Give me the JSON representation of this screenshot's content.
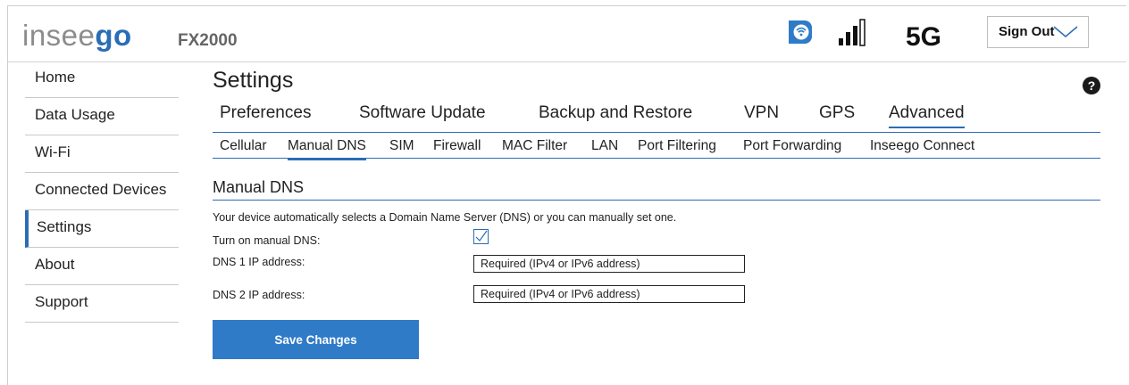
{
  "header": {
    "logo_prefix": "insee",
    "logo_suffix": "go",
    "model": "FX2000",
    "network": "5G",
    "sign_out_label": "Sign Out"
  },
  "sidebar": {
    "items": [
      {
        "label": "Home"
      },
      {
        "label": "Data Usage"
      },
      {
        "label": "Wi-Fi"
      },
      {
        "label": "Connected Devices"
      },
      {
        "label": "Settings",
        "active": true
      },
      {
        "label": "About"
      },
      {
        "label": "Support"
      }
    ]
  },
  "main": {
    "title": "Settings",
    "help_label": "?",
    "tabs": [
      {
        "label": "Preferences"
      },
      {
        "label": "Software Update"
      },
      {
        "label": "Backup and Restore"
      },
      {
        "label": "VPN"
      },
      {
        "label": "GPS"
      },
      {
        "label": "Advanced",
        "active": true
      }
    ],
    "subtabs": [
      {
        "label": "Cellular"
      },
      {
        "label": "Manual DNS",
        "active": true
      },
      {
        "label": "SIM"
      },
      {
        "label": "Firewall"
      },
      {
        "label": "MAC Filter"
      },
      {
        "label": "LAN"
      },
      {
        "label": "Port Filtering"
      },
      {
        "label": "Port Forwarding"
      },
      {
        "label": "Inseego Connect"
      }
    ],
    "section_title": "Manual DNS",
    "description": "Your device automatically selects a Domain  Name Server (DNS) or you can manually set one.",
    "manual_dns_label": "Turn on manual DNS:",
    "manual_dns_checked": true,
    "dns1_label": "DNS 1 IP address:",
    "dns1_placeholder": "Required (IPv4 or IPv6 address)",
    "dns2_label": "DNS 2 IP address:",
    "dns2_placeholder": "Required (IPv4 or IPv6 address)",
    "save_label": "Save Changes"
  },
  "colors": {
    "accent": "#2a6db5",
    "button": "#2f7bc7"
  },
  "icons": {
    "wifi_badge": "wifi-badge-icon",
    "signal": "signal-strength-icon",
    "chevron": "chevron-down-icon",
    "help": "help-icon",
    "check": "check-icon"
  }
}
